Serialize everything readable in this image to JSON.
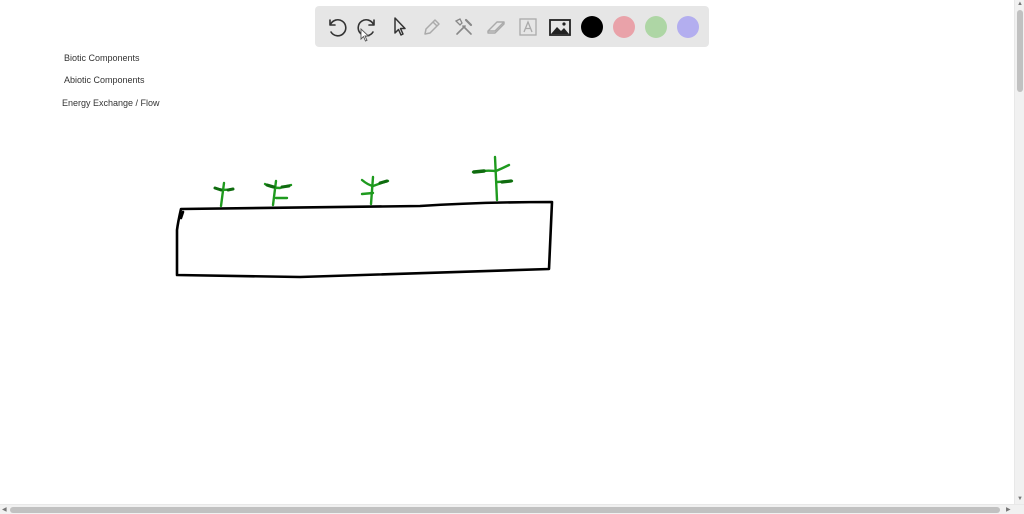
{
  "toolbar": {
    "tools": [
      {
        "name": "undo-icon"
      },
      {
        "name": "redo-icon"
      },
      {
        "name": "select-pointer-icon"
      },
      {
        "name": "pencil-icon"
      },
      {
        "name": "tools-icon"
      },
      {
        "name": "eraser-icon"
      },
      {
        "name": "text-icon"
      },
      {
        "name": "image-icon"
      }
    ],
    "colors": [
      "#000000",
      "#e9a2a9",
      "#aed6a5",
      "#b3aeef"
    ]
  },
  "labels": {
    "biotic": "Biotic Components",
    "abiotic": "Abiotic Components",
    "energy": "Energy Exchange / Flow"
  },
  "drawing": {
    "stroke_color": "#000000",
    "plant_color": "#1e9a1e",
    "leaf_color": "#0f6b0f"
  }
}
